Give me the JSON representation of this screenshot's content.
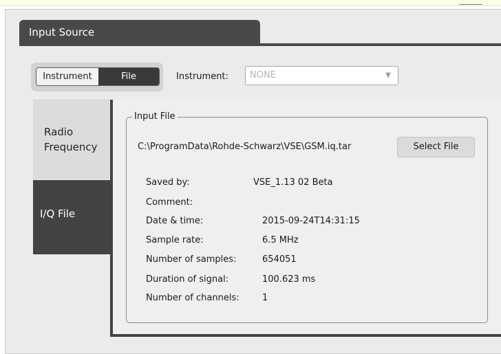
{
  "panel": {
    "title": "Input Source"
  },
  "source_toggle": {
    "instrument": "Instrument",
    "file": "File",
    "selected": "File"
  },
  "instrument_select": {
    "label": "Instrument:",
    "value": "NONE"
  },
  "sidebar": {
    "items": [
      {
        "label_line1": "Radio",
        "label_line2": "Frequency"
      },
      {
        "label": "I/Q File"
      }
    ]
  },
  "input_file": {
    "group_title": "Input File",
    "path": "C:\\ProgramData\\Rohde-Schwarz\\VSE\\GSM.iq.tar",
    "select_button": "Select File",
    "fields": [
      {
        "label": "Saved by:",
        "value": "VSE_1.13 02 Beta"
      },
      {
        "label": "Comment:",
        "value": ""
      },
      {
        "label": "Date & time:",
        "value": "2015-09-24T14:31:15"
      },
      {
        "label": "Sample rate:",
        "value": "6.5 MHz"
      },
      {
        "label": "Number of samples:",
        "value": "654051"
      },
      {
        "label": "Duration of signal:",
        "value": "100.623 ms"
      },
      {
        "label": "Number of channels:",
        "value": "1"
      }
    ]
  }
}
